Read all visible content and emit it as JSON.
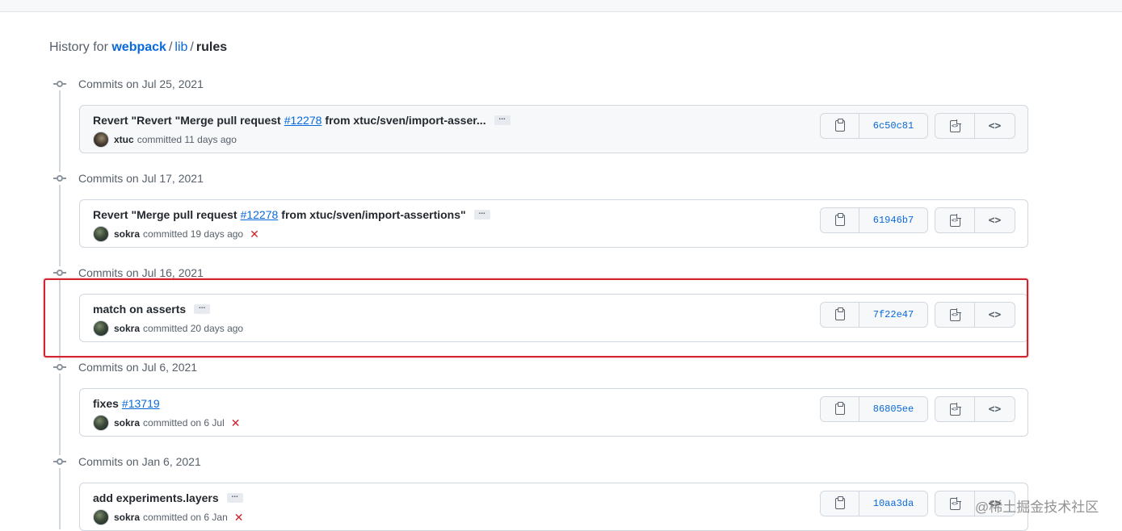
{
  "header": {
    "prefix": "History for",
    "repo": "webpack",
    "sep1": "/",
    "dir": "lib",
    "sep2": "/",
    "current": "rules"
  },
  "groups": [
    {
      "label": "Commits on Jul 25, 2021",
      "commit": {
        "title_pre": "Revert \"Revert \"Merge pull request",
        "pr": "#12278",
        "title_post": "from xtuc/sven/import-asser...",
        "has_ellipsis": true,
        "ellipsis": "...",
        "author": "xtuc",
        "committed": "committed 11 days ago",
        "status_failed": false,
        "sha": "6c50c81"
      }
    },
    {
      "label": "Commits on Jul 17, 2021",
      "commit": {
        "title_pre": "Revert \"Merge pull request",
        "pr": "#12278",
        "title_post": "from xtuc/sven/import-assertions\"",
        "has_ellipsis": true,
        "ellipsis": "...",
        "author": "sokra",
        "committed": "committed 19 days ago",
        "status_failed": true,
        "status_icon": "✕",
        "sha": "61946b7"
      }
    },
    {
      "label": "Commits on Jul 16, 2021",
      "commit": {
        "title_pre": "match on asserts",
        "pr": "",
        "title_post": "",
        "has_ellipsis": true,
        "ellipsis": "...",
        "author": "sokra",
        "committed": "committed 20 days ago",
        "status_failed": false,
        "sha": "7f22e47"
      }
    },
    {
      "label": "Commits on Jul 6, 2021",
      "commit": {
        "title_pre": "fixes",
        "pr": "#13719",
        "title_post": "",
        "has_ellipsis": false,
        "author": "sokra",
        "committed": "committed on 6 Jul",
        "status_failed": true,
        "status_icon": "✕",
        "sha": "86805ee"
      }
    },
    {
      "label": "Commits on Jan 6, 2021",
      "commit": {
        "title_pre": "add experiments.layers",
        "pr": "",
        "title_post": "",
        "has_ellipsis": true,
        "ellipsis": "...",
        "author": "sokra",
        "committed": "committed on 6 Jan",
        "status_failed": true,
        "status_icon": "✕",
        "sha": "10aa3da"
      }
    }
  ],
  "icons": {
    "copy": "clipboard-icon",
    "browse_files": "file-code-icon",
    "browse_code": "code-icon",
    "code_glyph": "<>",
    "file_code_glyph": "<>"
  },
  "colors": {
    "link": "#0969da",
    "fail": "#cf222e",
    "highlight": "#d1242f"
  },
  "watermark": "@稀土掘金技术社区"
}
